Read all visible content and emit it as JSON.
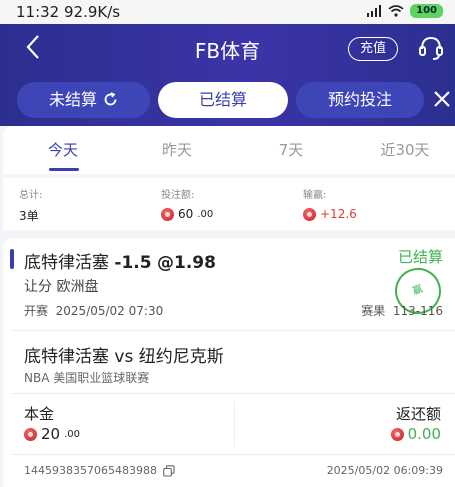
{
  "status_bar": {
    "time": "11:32",
    "speed": "92.9K/s",
    "battery": "100"
  },
  "header": {
    "title": "FB体育",
    "recharge_label": "充值"
  },
  "tabs": [
    {
      "label": "未结算"
    },
    {
      "label": "已结算"
    },
    {
      "label": "预约投注"
    }
  ],
  "periods": [
    "今天",
    "昨天",
    "7天",
    "近30天"
  ],
  "summary": {
    "total_label": "总计:",
    "total_value": "3单",
    "stake_label": "投注额:",
    "stake_value": "60",
    "stake_decimals": ".00",
    "pnl_label": "输赢:",
    "pnl_value": "+12.6"
  },
  "bet": {
    "team": "底特律活塞",
    "handicap": "-1.5",
    "odds": "@1.98",
    "status": "已结算",
    "stamp_text": "赢",
    "market": "让分 欧洲盘",
    "kickoff_label": "开赛",
    "kickoff_time": "2025/05/02 07:30",
    "result_label": "赛果",
    "result": "113-116",
    "match": "底特律活塞 vs 纽约尼克斯",
    "league": "NBA 美国职业篮球联赛",
    "stake_label": "本金",
    "stake_value": "20",
    "stake_decimals": ".00",
    "return_label": "返还额",
    "return_value": "0.00",
    "ticket_id": "1445938357065483988",
    "placed_time": "2025/05/02 06:09:39"
  }
}
